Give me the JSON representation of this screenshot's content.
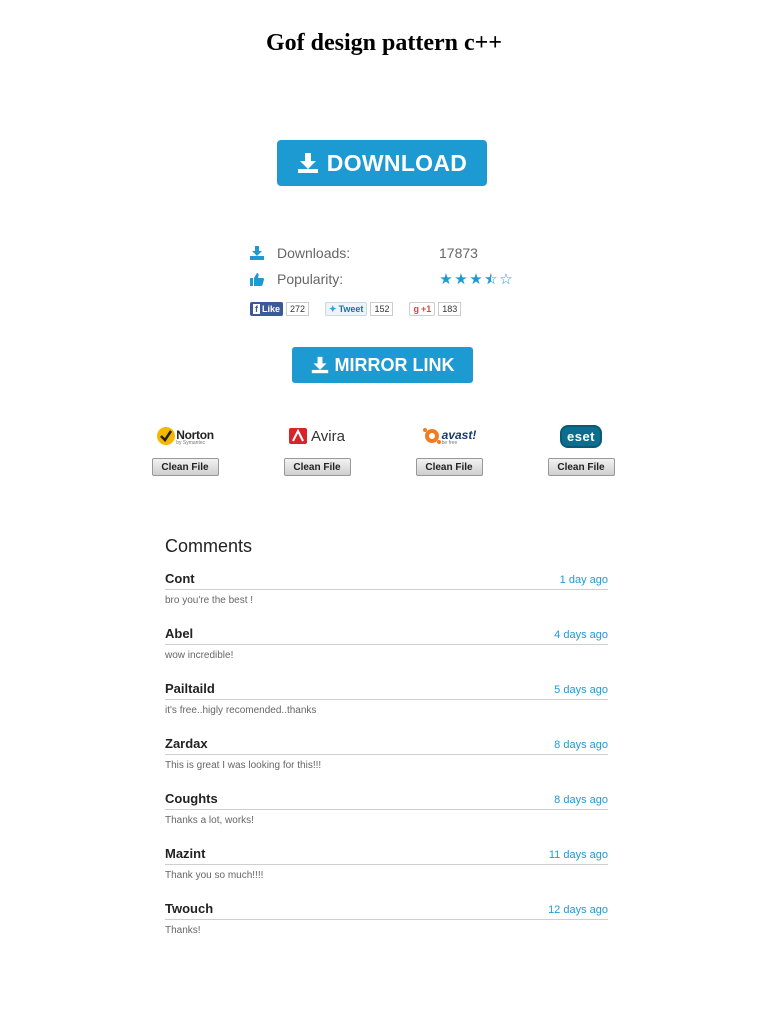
{
  "page": {
    "title": "Gof design pattern c++"
  },
  "download_button": {
    "label": "DOWNLOAD"
  },
  "stats": {
    "downloads_label": "Downloads:",
    "downloads_value": "17873",
    "popularity_label": "Popularity:",
    "rating": 3.5,
    "rating_max": 5
  },
  "social": {
    "facebook": {
      "label": "Like",
      "count": "272"
    },
    "twitter": {
      "label": "Tweet",
      "count": "152"
    },
    "google": {
      "label": "+1",
      "count": "183"
    }
  },
  "mirror_button": {
    "label": "MIRROR LINK"
  },
  "antivirus": [
    {
      "name": "Norton",
      "sub": "by Symantec",
      "badge": "Clean File"
    },
    {
      "name": "Avira",
      "badge": "Clean File"
    },
    {
      "name": "avast!",
      "sub": "be free",
      "badge": "Clean File"
    },
    {
      "name": "eset",
      "badge": "Clean File"
    }
  ],
  "comments": {
    "heading": "Comments",
    "items": [
      {
        "name": "Cont",
        "date": "1 day ago",
        "text": "bro you're the best !"
      },
      {
        "name": "Abel",
        "date": "4 days ago",
        "text": "wow incredible!"
      },
      {
        "name": "Pailtaild",
        "date": "5 days ago",
        "text": "it's free..higly recomended..thanks"
      },
      {
        "name": "Zardax",
        "date": "8 days ago",
        "text": "This is great I was looking for this!!!"
      },
      {
        "name": "Coughts",
        "date": "8 days ago",
        "text": "Thanks a lot, works!"
      },
      {
        "name": "Mazint",
        "date": "11 days ago",
        "text": "Thank you so much!!!!"
      },
      {
        "name": "Twouch",
        "date": "12 days ago",
        "text": "Thanks!"
      }
    ]
  },
  "colors": {
    "accent": "#1e9ad3",
    "facebook": "#3b5998",
    "norton": "#f5b800",
    "avira": "#d8232a",
    "avast": "#f47b20",
    "eset": "#0c6d8f"
  }
}
